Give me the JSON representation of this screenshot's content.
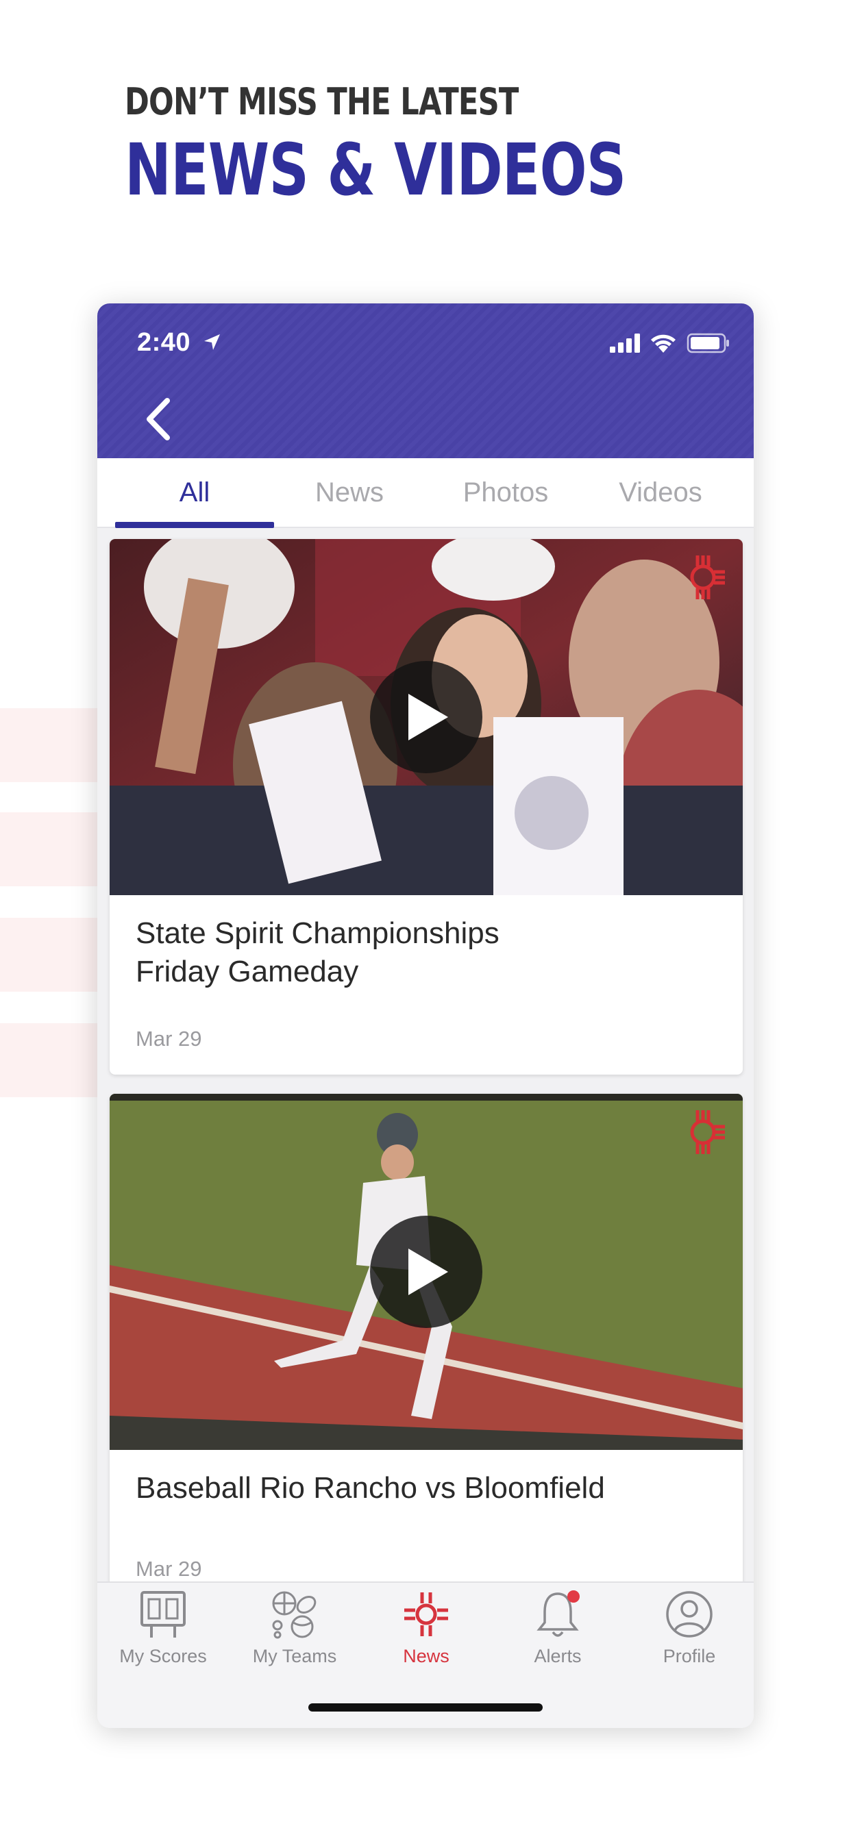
{
  "promo": {
    "kicker": "DON’T MISS THE LATEST",
    "title": "NEWS & VIDEOS"
  },
  "status_bar": {
    "time": "2:40",
    "icons": [
      "location-arrow-icon",
      "cellular-signal-icon",
      "wifi-icon",
      "battery-icon"
    ]
  },
  "colors": {
    "brand_purple": "#4a43a9",
    "tab_active": "#2f2f9a",
    "news_red": "#d6343e"
  },
  "tabs": [
    {
      "label": "All",
      "active": true
    },
    {
      "label": "News",
      "active": false
    },
    {
      "label": "Photos",
      "active": false
    },
    {
      "label": "Videos",
      "active": false
    }
  ],
  "cards": [
    {
      "title_line1": "State Spirit Championships",
      "title_line2": "Friday Gameday",
      "date": "Mar 29",
      "logo": "NMAA"
    },
    {
      "title_line1": "Baseball Rio Rancho vs Bloomfield",
      "date": "Mar 29",
      "logo": "NMAA"
    }
  ],
  "tabbar": [
    {
      "label": "My Scores",
      "icon": "scoreboard-icon",
      "active": false
    },
    {
      "label": "My Teams",
      "icon": "sports-balls-icon",
      "active": false
    },
    {
      "label": "News",
      "icon": "zia-sun-icon",
      "active": true
    },
    {
      "label": "Alerts",
      "icon": "bell-icon",
      "active": false,
      "badge": true
    },
    {
      "label": "Profile",
      "icon": "profile-icon",
      "active": false
    }
  ]
}
